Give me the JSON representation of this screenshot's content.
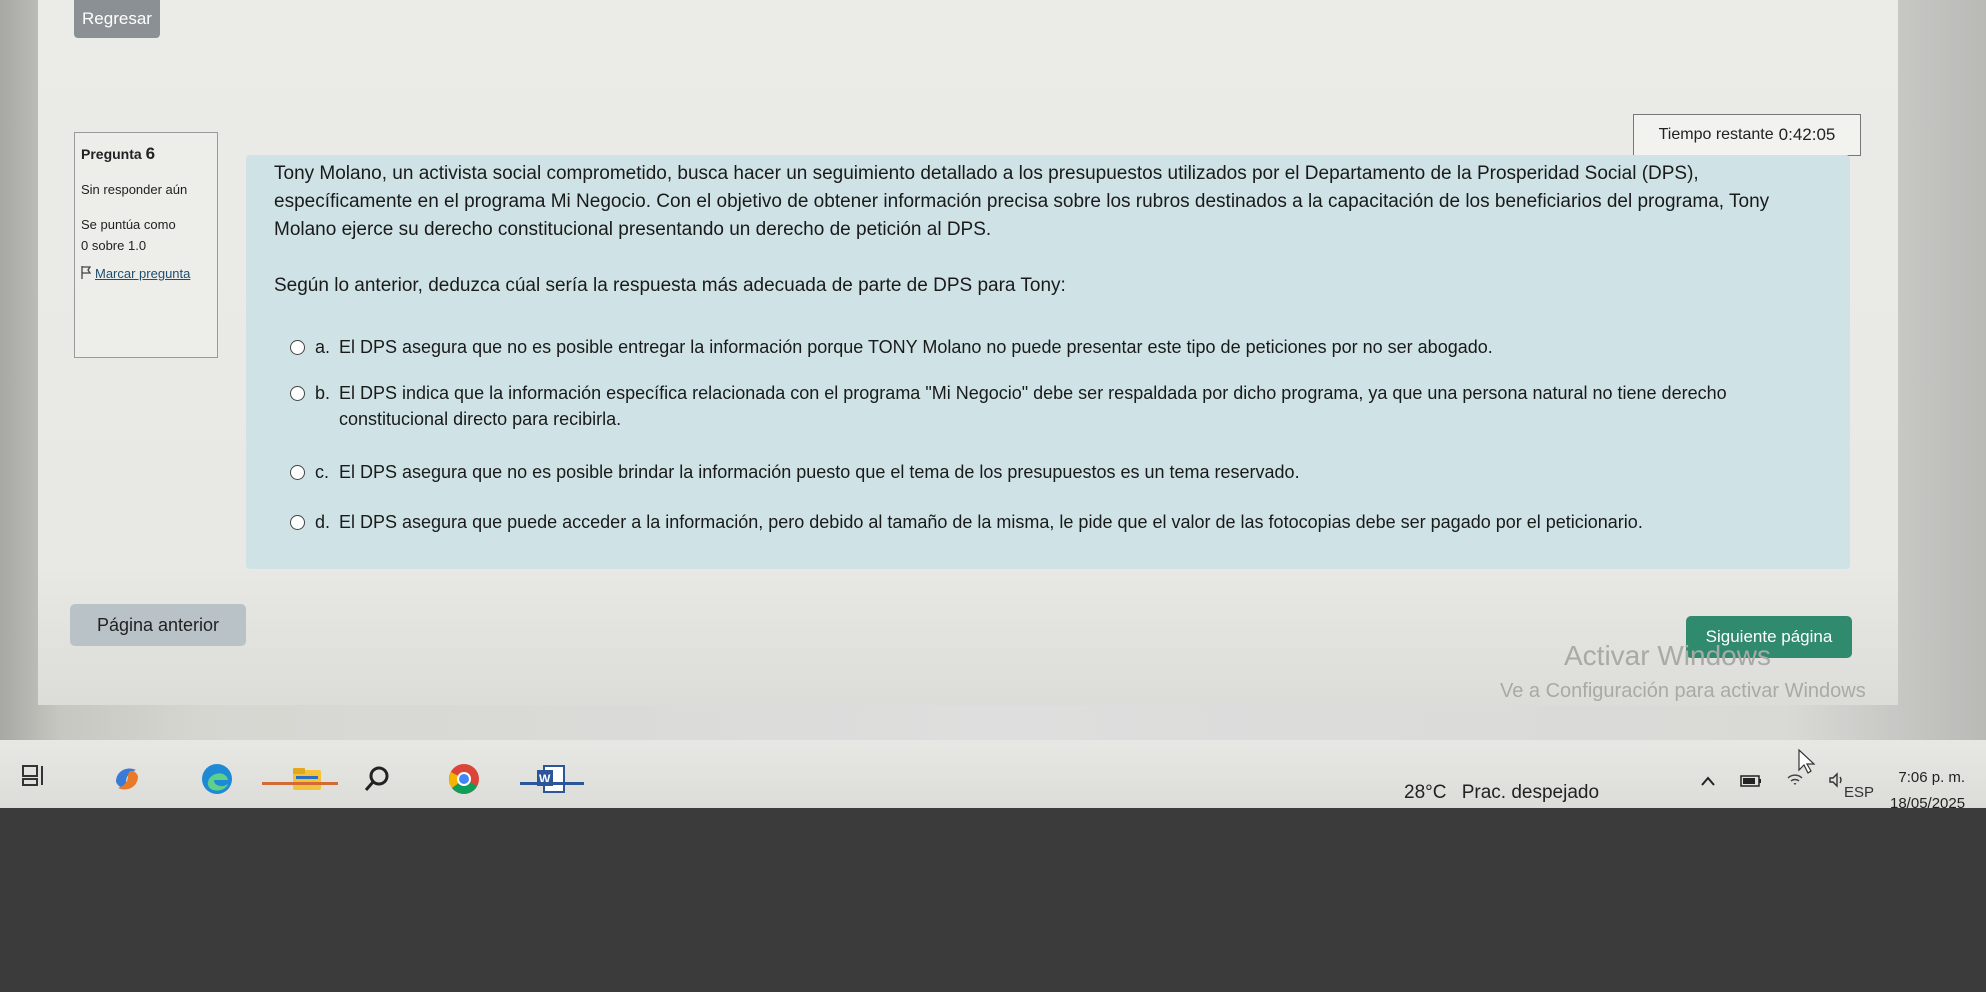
{
  "header": {
    "back_label": "Regresar"
  },
  "timer": {
    "label": "Tiempo restante",
    "value": "0:42:05"
  },
  "question_info": {
    "title": "Pregunta",
    "number": "6",
    "status": "Sin responder aún",
    "grade_label": "Se puntúa como",
    "grade_value": "0 sobre 1.0",
    "flag_label": "Marcar pregunta"
  },
  "question": {
    "text": "Tony Molano, un activista social comprometido, busca hacer un seguimiento detallado a los presupuestos utilizados por el Departamento de la Prosperidad Social (DPS), específicamente en el programa Mi Negocio. Con el objetivo de obtener información precisa sobre los rubros destinados a la capacitación de los beneficiarios del programa, Tony Molano ejerce su derecho constitucional presentando un derecho de petición al DPS.",
    "prompt": "Según lo anterior, deduzca cúal sería la respuesta más adecuada de parte de DPS para Tony:",
    "options": [
      {
        "letter": "a.",
        "text": "El DPS asegura que no es posible entregar la información porque TONY Molano no puede presentar este tipo de peticiones por no ser abogado."
      },
      {
        "letter": "b.",
        "text": "El DPS indica que la información específica relacionada con el programa \"Mi Negocio\" debe ser respaldada por dicho programa, ya que una persona natural no tiene derecho constitucional directo para recibirla."
      },
      {
        "letter": "c.",
        "text": "El DPS asegura que no es posible brindar la información puesto que el tema de los presupuestos es un tema reservado."
      },
      {
        "letter": "d.",
        "text": "El DPS asegura que puede acceder a la información, pero debido al tamaño de la misma, le pide que el valor de las fotocopias debe ser pagado por el peticionario."
      }
    ]
  },
  "navigation": {
    "prev_label": "Página anterior",
    "next_label": "Siguiente página"
  },
  "watermark": {
    "line1": "Activar Windows",
    "line2": "Ve a Configuración para activar Windows"
  },
  "taskbar": {
    "icons": [
      "task-view-icon",
      "copilot-icon",
      "edge-icon",
      "file-explorer-icon",
      "search-icon",
      "chrome-icon",
      "word-icon"
    ],
    "weather_temp": "28°C",
    "weather_text": "Prac. despejado",
    "language": "ESP",
    "time": "7:06 p. m.",
    "date": "18/05/2025"
  },
  "colors": {
    "next_button": "#2f8a6e",
    "question_box": "#cfe3e6",
    "back_button": "#8a9094"
  }
}
